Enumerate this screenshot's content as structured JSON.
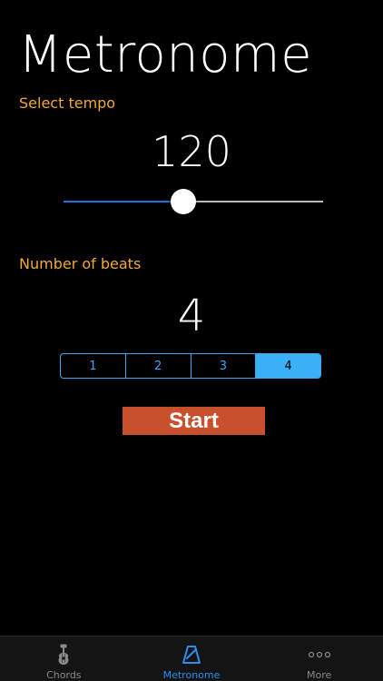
{
  "header": {
    "title": "Metronome"
  },
  "tempo": {
    "label": "Select tempo",
    "value": "120",
    "slider_fraction": 0.46
  },
  "beats": {
    "label": "Number of beats",
    "value": "4",
    "segments": [
      "1",
      "2",
      "3",
      "4"
    ],
    "selected": "4"
  },
  "start_button": {
    "label": "Start"
  },
  "tab_bar": {
    "tabs": [
      {
        "label": "Chords",
        "icon": "guitar-icon",
        "active": false
      },
      {
        "label": "Metronome",
        "icon": "metronome-icon",
        "active": true
      },
      {
        "label": "More",
        "icon": "more-dots-icon",
        "active": false
      }
    ]
  },
  "colors": {
    "accent_label": "#f0a93a",
    "slider_fill": "#1e6fe0",
    "segment_accent": "#3aa8f5",
    "start_button": "#c8502c",
    "tab_active": "#2f8cf0"
  }
}
